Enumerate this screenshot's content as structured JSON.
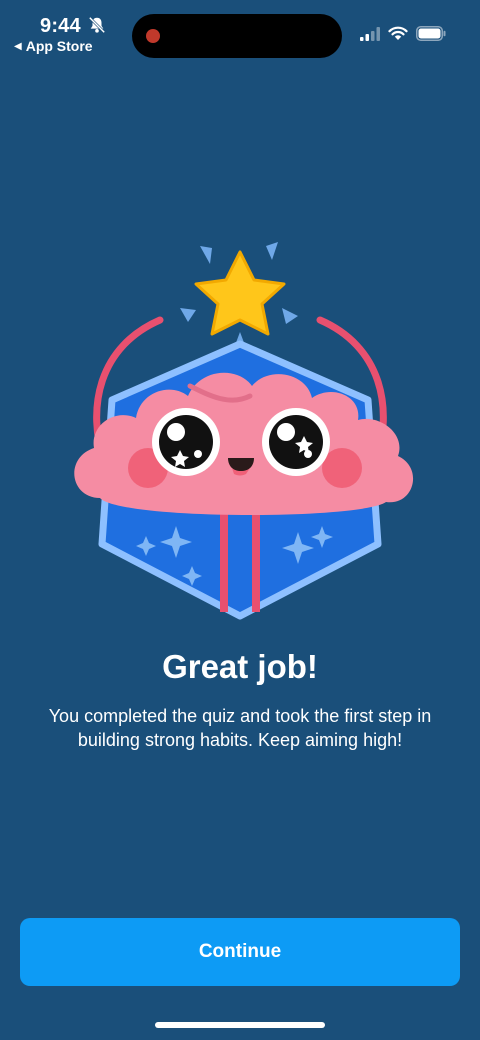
{
  "status_bar": {
    "time": "9:44",
    "back_label": "App Store",
    "icons": [
      "bell-off-icon",
      "signal-icon",
      "wifi-icon",
      "battery-icon"
    ]
  },
  "illustration": {
    "name": "brain-mascot-badge"
  },
  "main": {
    "title": "Great job!",
    "message": "You completed the quiz and took the first step in building strong habits. Keep aiming high!"
  },
  "footer": {
    "continue_label": "Continue"
  },
  "colors": {
    "background": "#1a4f7a",
    "button": "#0d9bf5",
    "brain": "#f58ca3",
    "star": "#ffc61a",
    "badge_fill": "#1f6fe0"
  }
}
